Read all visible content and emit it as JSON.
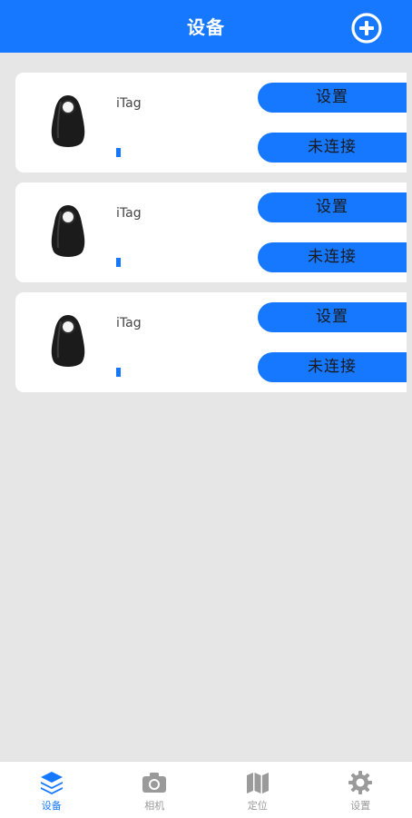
{
  "header": {
    "title": "设备"
  },
  "devices": [
    {
      "name": "iTag",
      "settings_label": "设置",
      "status_label": "未连接"
    },
    {
      "name": "iTag",
      "settings_label": "设置",
      "status_label": "未连接"
    },
    {
      "name": "iTag",
      "settings_label": "设置",
      "status_label": "未连接"
    }
  ],
  "tabbar": {
    "tabs": [
      {
        "label": "设备",
        "icon": "layers-icon",
        "active": true
      },
      {
        "label": "相机",
        "icon": "camera-icon",
        "active": false
      },
      {
        "label": "定位",
        "icon": "map-icon",
        "active": false
      },
      {
        "label": "设置",
        "icon": "gear-icon",
        "active": false
      }
    ]
  },
  "colors": {
    "accent": "#1677ff",
    "background": "#e6e6e6",
    "inactive": "#999999"
  }
}
